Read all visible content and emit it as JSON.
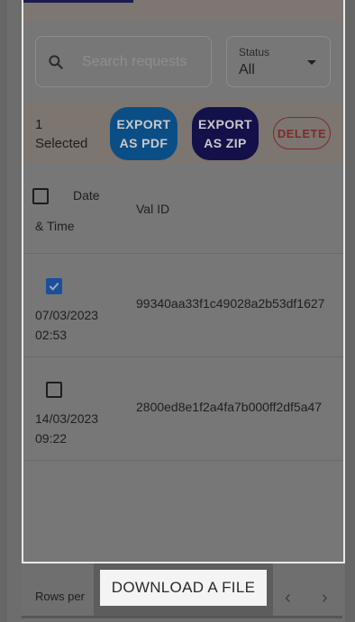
{
  "search": {
    "placeholder": "Search requests"
  },
  "status_filter": {
    "label": "Status",
    "value": "All"
  },
  "selection": {
    "count_line1": "1",
    "count_line2": "Selected"
  },
  "actions": {
    "export_pdf_line1": "EXPORT",
    "export_pdf_line2": "AS PDF",
    "export_zip_line1": "EXPORT",
    "export_zip_line2": "AS ZIP",
    "delete": "DELETE"
  },
  "table": {
    "headers": {
      "date_line1": "Date",
      "date_line2": "& Time",
      "val_id": "Val ID"
    },
    "rows": [
      {
        "checked": true,
        "date": "07/03/2023",
        "time": "02:53",
        "val_id": "99340aa33f1c49028a2b53df1627"
      },
      {
        "checked": false,
        "date": "14/03/2023",
        "time": "09:22",
        "val_id": "2800ed8e1f2a4fa7b000ff2df5a47"
      }
    ]
  },
  "footer": {
    "rows_per": "Rows per",
    "prev": "‹",
    "next": "›"
  },
  "download": {
    "label": "DOWNLOAD A FILE"
  },
  "colors": {
    "export_pdf": "#0b4e86",
    "export_zip": "#14104a",
    "delete": "#7b2d2a",
    "overlay": "#777777"
  }
}
